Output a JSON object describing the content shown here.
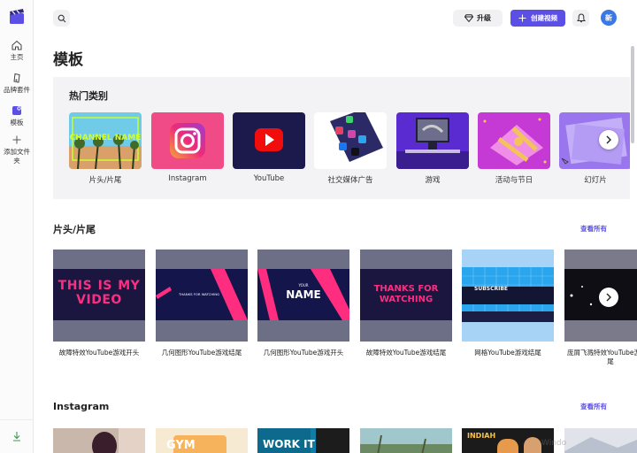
{
  "rail": {
    "items": [
      {
        "label": "主页"
      },
      {
        "label": "品牌套件"
      },
      {
        "label": "模板"
      },
      {
        "label": "添加文件夹"
      }
    ]
  },
  "topbar": {
    "upgrade_label": "升级",
    "create_label": "创建视频",
    "avatar_text": "新"
  },
  "page_title": "模板",
  "hot": {
    "title": "热门类别",
    "categories": [
      {
        "label": "片头/片尾",
        "thumb_text": "CHANNEL NAME"
      },
      {
        "label": "Instagram"
      },
      {
        "label": "YouTube"
      },
      {
        "label": "社交媒体广告"
      },
      {
        "label": "游戏"
      },
      {
        "label": "活动与节日"
      },
      {
        "label": "幻灯片"
      }
    ]
  },
  "intro": {
    "title": "片头/片尾",
    "see_all": "查看所有",
    "templates": [
      {
        "label": "故障特效YouTube游戏开头",
        "thumb_text": "THIS IS MY VIDEO"
      },
      {
        "label": "几何图形YouTube游戏结尾",
        "thumb_text": "THANKS FOR WATCHING"
      },
      {
        "label": "几何图形YouTube游戏开头",
        "thumb_text_small": "YOUR",
        "thumb_text": "NAME"
      },
      {
        "label": "故障特效YouTube游戏结尾",
        "thumb_text": "THANKS FOR WATCHING"
      },
      {
        "label": "网格YouTube游戏结尾",
        "thumb_text": "SUBSCRIBE"
      },
      {
        "label": "庞屑飞溅特效YouTube游戏结尾"
      }
    ]
  },
  "instagram": {
    "title": "Instagram",
    "see_all": "查看所有",
    "thumbs": [
      {
        "text": ""
      },
      {
        "text": "GYM"
      },
      {
        "text": "WORK IT"
      },
      {
        "text": ""
      },
      {
        "text": "INDIAH"
      },
      {
        "text": ""
      }
    ]
  },
  "watermark": "Windo",
  "colors": {
    "accent": "#5b4fe6",
    "avatar": "#3a78e8"
  }
}
